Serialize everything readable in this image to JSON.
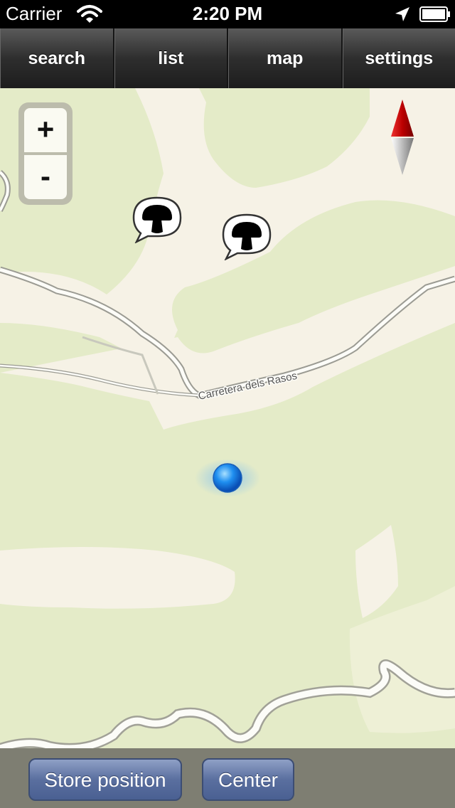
{
  "status": {
    "carrier": "Carrier",
    "time": "2:20 PM"
  },
  "tabs": [
    {
      "label": "search"
    },
    {
      "label": "list"
    },
    {
      "label": "map"
    },
    {
      "label": "settings"
    }
  ],
  "map": {
    "road_label": "Carretera dels Rasos",
    "zoom_in": "+",
    "zoom_out": "-",
    "markers": [
      {
        "icon": "mushroom-icon"
      },
      {
        "icon": "mushroom-icon"
      }
    ]
  },
  "toolbar": {
    "store_label": "Store position",
    "center_label": "Center"
  },
  "colors": {
    "map_green": "#e4ebc8",
    "map_cream": "#f6f2e6",
    "button_blue": "#5a6f9f",
    "location_blue": "#1f8ff0"
  }
}
